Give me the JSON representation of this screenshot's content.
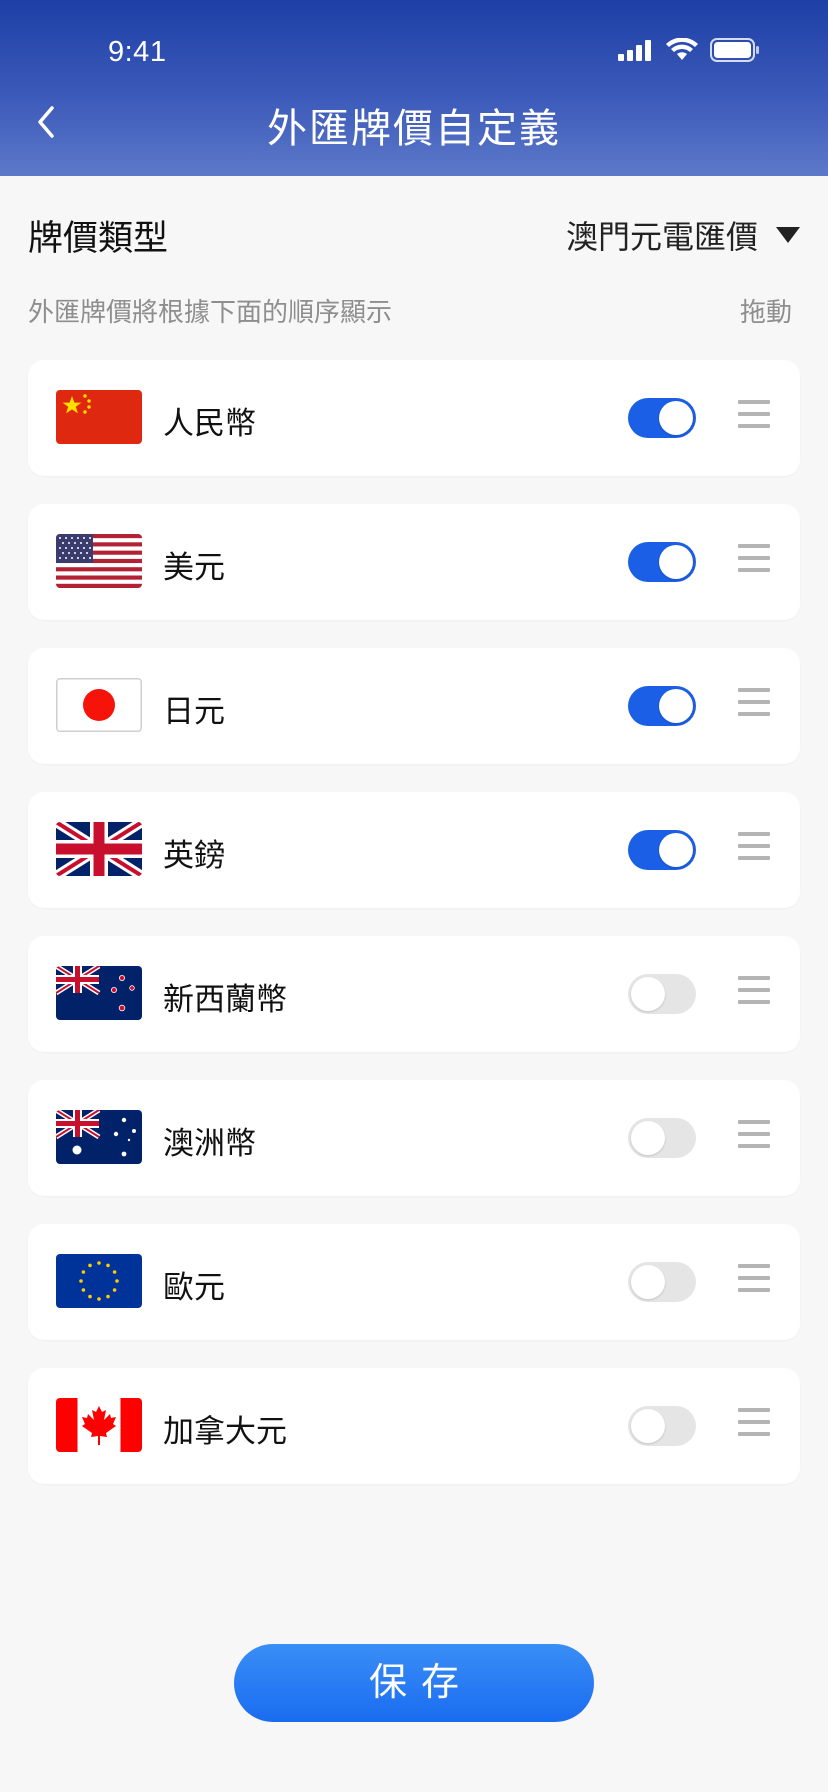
{
  "status_bar": {
    "time": "9:41"
  },
  "header": {
    "title": "外匯牌價自定義"
  },
  "rate_type": {
    "label": "牌價類型",
    "selected": "澳門元電匯價"
  },
  "hint": {
    "text": "外匯牌價將根據下面的順序顯示",
    "drag_label": "拖動"
  },
  "currencies": [
    {
      "name": "人民幣",
      "flag": "china-flag",
      "enabled": true
    },
    {
      "name": "美元",
      "flag": "usa-flag",
      "enabled": true
    },
    {
      "name": "日元",
      "flag": "japan-flag",
      "enabled": true
    },
    {
      "name": "英鎊",
      "flag": "uk-flag",
      "enabled": true
    },
    {
      "name": "新西蘭幣",
      "flag": "new-zealand-flag",
      "enabled": false
    },
    {
      "name": "澳洲幣",
      "flag": "australia-flag",
      "enabled": false
    },
    {
      "name": "歐元",
      "flag": "eu-flag",
      "enabled": false
    },
    {
      "name": "加拿大元",
      "flag": "canada-flag",
      "enabled": false
    }
  ],
  "save_button": {
    "label": "保存"
  },
  "colors": {
    "header_top": "#1d3fa6",
    "toggle_on": "#1a5fe6",
    "toggle_off": "#e5e5e5",
    "button": "#1a6cf0"
  }
}
